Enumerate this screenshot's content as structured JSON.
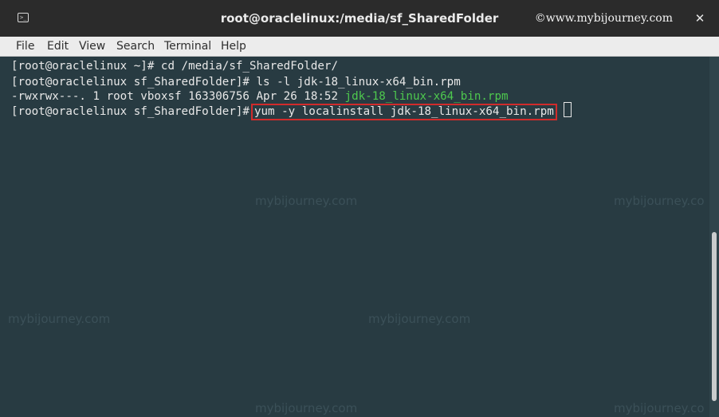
{
  "window": {
    "title": "root@oraclelinux:/media/sf_SharedFolder",
    "watermark": "©www.mybijourney.com",
    "close_glyph": "✕",
    "icon": "terminal-icon"
  },
  "menu": {
    "items": [
      "File",
      "Edit",
      "View",
      "Search",
      "Terminal",
      "Help"
    ]
  },
  "terminal": {
    "line1": "[root@oraclelinux ~]# cd /media/sf_SharedFolder/",
    "line2": "[root@oraclelinux sf_SharedFolder]# ls -l jdk-18_linux-x64_bin.rpm",
    "line3_prefix": "-rwxrwx---. 1 root vboxsf 163306756 Apr 26 18:52 ",
    "line3_file": "jdk-18_linux-x64_bin.rpm",
    "line4_prompt": "[root@oraclelinux sf_SharedFolder]#",
    "line4_command": "yum -y localinstall jdk-18_linux-x64_bin.rpm"
  },
  "background_watermarks": {
    "w1": "mybijourney.com",
    "w2": "mybijourney.co",
    "w3": "mybijourney.com",
    "w4": "mybijourney.com",
    "w5": "mybijourney.com",
    "w6": "mybijourney.co"
  },
  "colors": {
    "filename_green": "#4ec94e",
    "highlight_red": "#d12b2b",
    "terminal_bg": "#283b42"
  }
}
